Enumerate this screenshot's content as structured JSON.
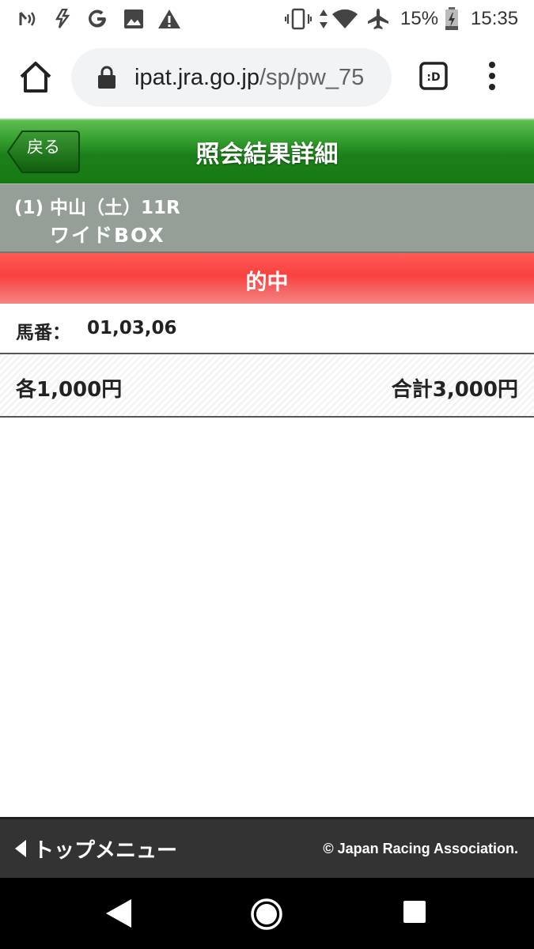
{
  "status_bar": {
    "battery_percent": "15%",
    "time": "15:35",
    "icons": [
      "nfc-icon",
      "bolt-hand-icon",
      "google-icon",
      "image-icon",
      "warning-icon",
      "vibrate-icon",
      "data-arrows-icon",
      "wifi-icon",
      "airplane-icon",
      "battery-charging-icon"
    ]
  },
  "browser": {
    "url_host": "ipat.jra.go.jp",
    "url_path": "/sp/pw_75",
    "tab_icon_label": ":D"
  },
  "header": {
    "back_label": "戻る",
    "title": "照会結果詳細"
  },
  "race": {
    "line1": "(1) 中山（土）11R",
    "bet_type": "ワイドBOX"
  },
  "result": {
    "label": "的中"
  },
  "horses": {
    "label": "馬番：",
    "value": "01,03,06"
  },
  "amount": {
    "each": "各1,000円",
    "total": "合計3,000円"
  },
  "footer": {
    "top_menu": "トップメニュー",
    "copyright": "© Japan Racing Association."
  },
  "colors": {
    "header_green": "#1d7f1b",
    "race_gray": "#959e97",
    "hit_red": "#f9423f",
    "footer_bg": "#333333"
  }
}
